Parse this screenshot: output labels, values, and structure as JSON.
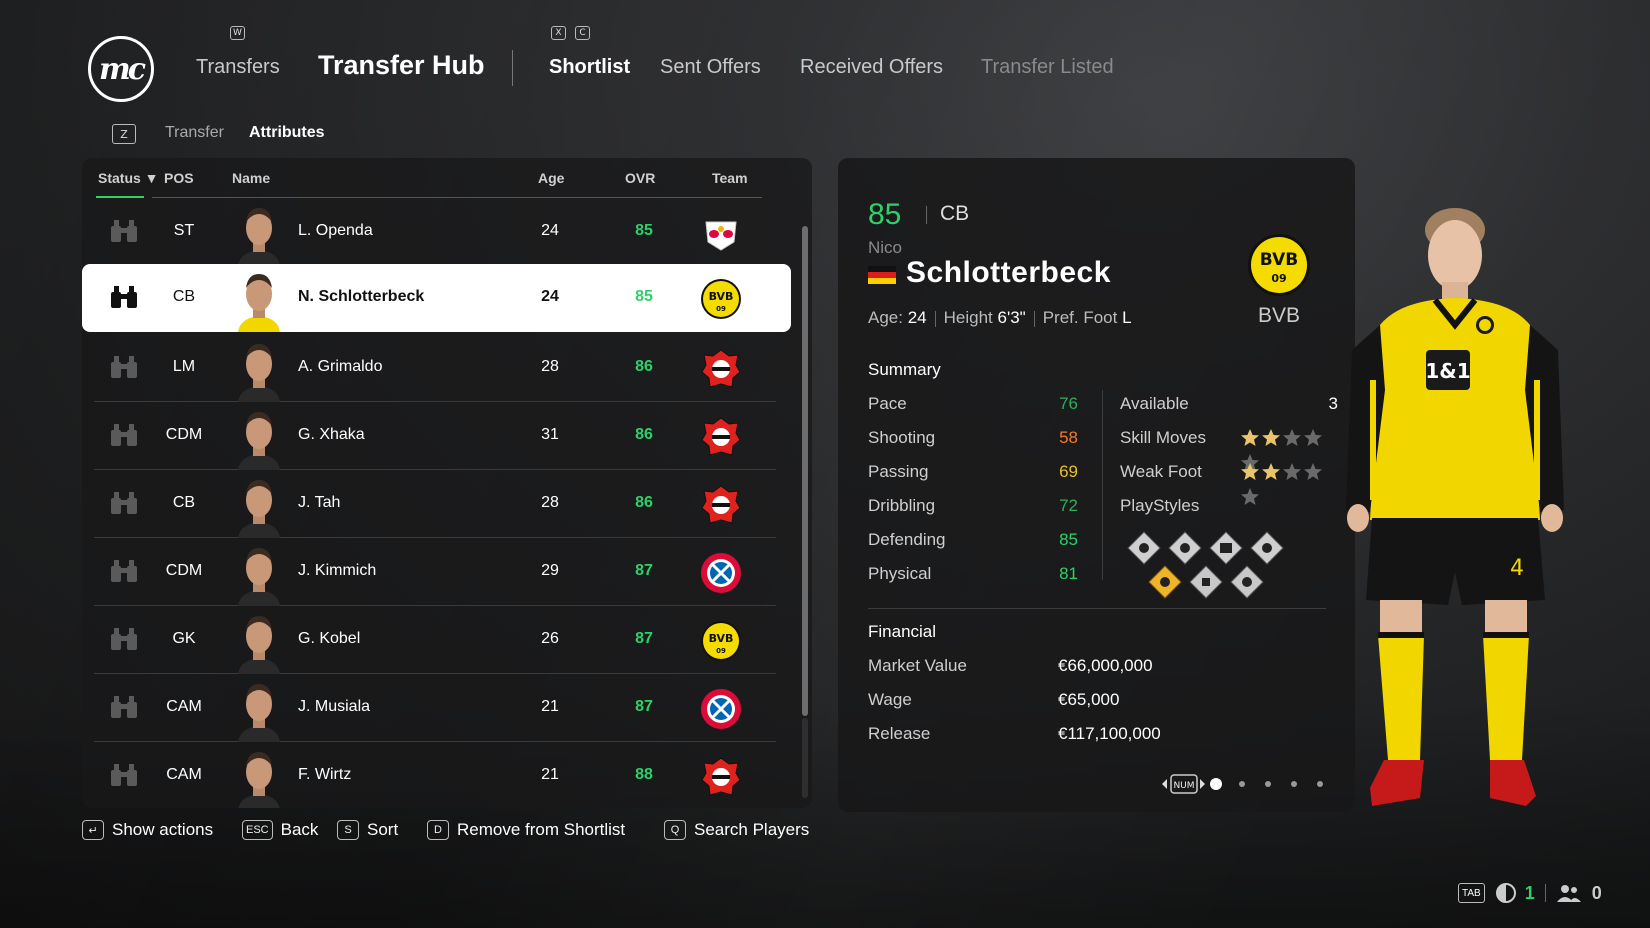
{
  "header": {
    "nav_transfers": "Transfers",
    "title": "Transfer Hub",
    "tabs": [
      "Shortlist",
      "Sent Offers",
      "Received Offers",
      "Transfer Listed"
    ],
    "key_w": "W",
    "key_x": "X",
    "key_c": "C"
  },
  "breadcrumb": {
    "key": "Z",
    "items": [
      "Transfer",
      "Attributes"
    ]
  },
  "list": {
    "columns": {
      "status": "Status",
      "pos": "POS",
      "name": "Name",
      "age": "Age",
      "ovr": "OVR",
      "team": "Team"
    },
    "rows": [
      {
        "pos": "ST",
        "name": "L. Openda",
        "age": "24",
        "ovr": "85",
        "team": "rb-leipzig"
      },
      {
        "pos": "CB",
        "name": "N. Schlotterbeck",
        "age": "24",
        "ovr": "85",
        "team": "bvb"
      },
      {
        "pos": "LM",
        "name": "A. Grimaldo",
        "age": "28",
        "ovr": "86",
        "team": "leverkusen"
      },
      {
        "pos": "CDM",
        "name": "G. Xhaka",
        "age": "31",
        "ovr": "86",
        "team": "leverkusen"
      },
      {
        "pos": "CB",
        "name": "J. Tah",
        "age": "28",
        "ovr": "86",
        "team": "leverkusen"
      },
      {
        "pos": "CDM",
        "name": "J. Kimmich",
        "age": "29",
        "ovr": "87",
        "team": "bayern"
      },
      {
        "pos": "GK",
        "name": "G. Kobel",
        "age": "26",
        "ovr": "87",
        "team": "bvb"
      },
      {
        "pos": "CAM",
        "name": "J. Musiala",
        "age": "21",
        "ovr": "87",
        "team": "bayern"
      },
      {
        "pos": "CAM",
        "name": "F. Wirtz",
        "age": "21",
        "ovr": "88",
        "team": "leverkusen"
      }
    ],
    "selected_index": 1
  },
  "detail": {
    "ovr": "85",
    "pos": "CB",
    "first_name": "Nico",
    "last_name": "Schlotterbeck",
    "club_abbr": "BVB",
    "age_label": "Age:",
    "age": "24",
    "height_label": "Height",
    "height": "6'3\"",
    "foot_label": "Pref. Foot",
    "foot": "L",
    "summary_title": "Summary",
    "stats": [
      {
        "label": "Pace",
        "value": "76",
        "color": "#2fae5c"
      },
      {
        "label": "Shooting",
        "value": "58",
        "color": "#f07b2e"
      },
      {
        "label": "Passing",
        "value": "69",
        "color": "#e8c12c"
      },
      {
        "label": "Dribbling",
        "value": "72",
        "color": "#2fae5c"
      },
      {
        "label": "Defending",
        "value": "85",
        "color": "#2fd068"
      },
      {
        "label": "Physical",
        "value": "81",
        "color": "#2fd068"
      }
    ],
    "available_label": "Available",
    "available": "3",
    "skill_moves_label": "Skill Moves",
    "skill_moves": 2,
    "weak_foot_label": "Weak Foot",
    "weak_foot": 2,
    "playstyles_label": "PlayStyles",
    "financial_title": "Financial",
    "market_value_label": "Market Value",
    "market_value": "€66,000,000",
    "wage_label": "Wage",
    "wage": "€65,000",
    "release_label": "Release",
    "release": "€117,100,000",
    "pager_key": "NUM",
    "pages": 5,
    "page_current": 1
  },
  "hints": [
    {
      "key": "↵",
      "label": "Show actions"
    },
    {
      "key": "ESC",
      "label": "Back"
    },
    {
      "key": "S",
      "label": "Sort"
    },
    {
      "key": "D",
      "label": "Remove from Shortlist"
    },
    {
      "key": "Q",
      "label": "Search Players"
    }
  ],
  "status_bar": {
    "key": "TAB",
    "count_a": "1",
    "count_b": "0"
  },
  "colors": {
    "accent": "#2fd068",
    "panel": "#18181a",
    "bvb_yellow": "#f5dc00"
  }
}
